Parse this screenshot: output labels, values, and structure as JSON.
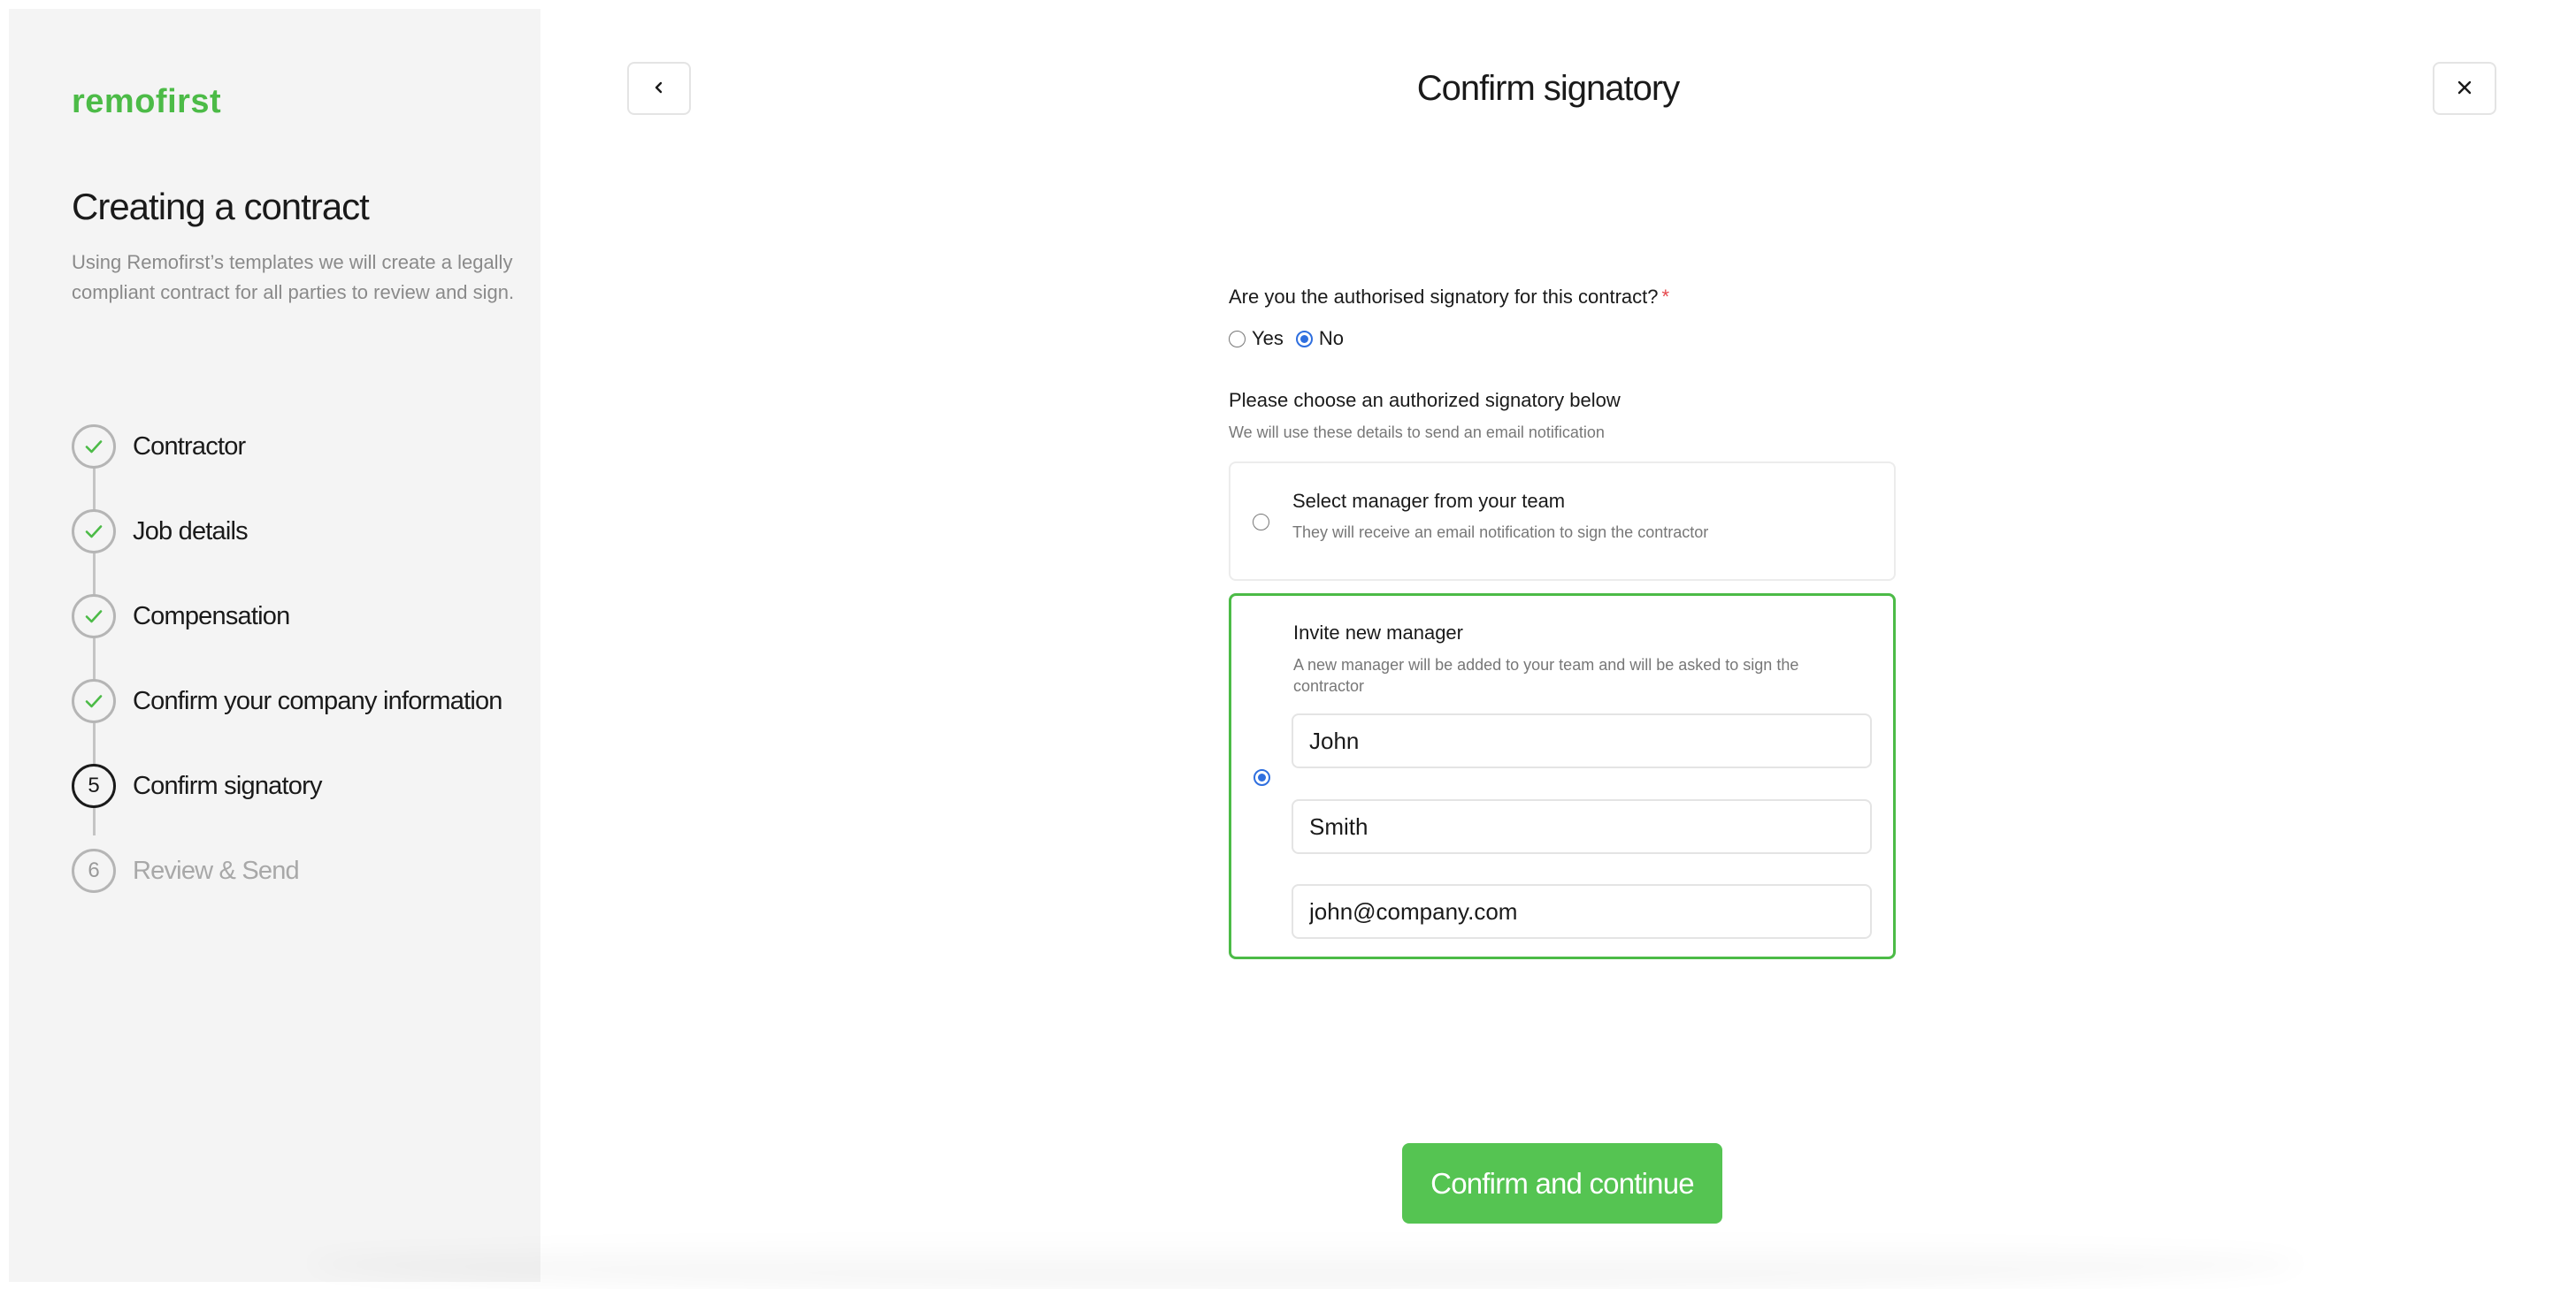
{
  "brand": {
    "logo_text": "remofirst",
    "accent": "#4cbb47"
  },
  "sidebar": {
    "title": "Creating a contract",
    "description": "Using Remofirst’s templates we will create a legally compliant contract for all parties to review and sign.",
    "steps": [
      {
        "number": "1",
        "label": "Contractor",
        "status": "done"
      },
      {
        "number": "2",
        "label": "Job details",
        "status": "done"
      },
      {
        "number": "3",
        "label": "Compensation",
        "status": "done"
      },
      {
        "number": "4",
        "label": "Confirm your company information",
        "status": "done"
      },
      {
        "number": "5",
        "label": "Confirm signatory",
        "status": "active"
      },
      {
        "number": "6",
        "label": "Review & Send",
        "status": "todo"
      }
    ]
  },
  "header": {
    "title": "Confirm signatory",
    "back_icon": "chevron-left-icon",
    "close_icon": "close-icon"
  },
  "form": {
    "question": "Are you the authorised signatory for this contract?",
    "required_mark": "*",
    "answer_options": [
      {
        "label": "Yes",
        "checked": false
      },
      {
        "label": "No",
        "checked": true
      }
    ],
    "section_label": "Please choose an authorized signatory below",
    "section_hint": "We will use these details to send an email notification",
    "option_select": {
      "title": "Select manager from your team",
      "description": "They will receive an email notification to sign the contractor",
      "checked": false
    },
    "option_invite": {
      "title": "Invite new manager",
      "description": "A new manager will be added to your team and will be asked to sign the contractor",
      "checked": true,
      "first_name": "John",
      "last_name": "Smith",
      "email": "john@company.com"
    }
  },
  "actions": {
    "confirm_label": "Confirm and continue"
  }
}
